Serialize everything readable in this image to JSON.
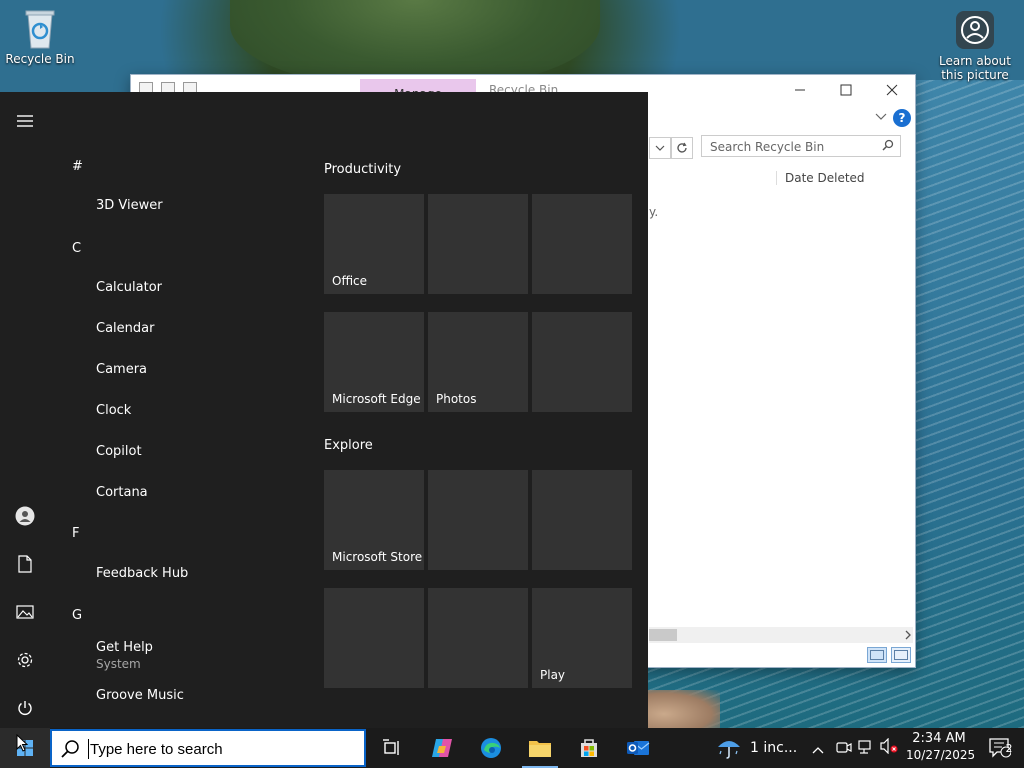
{
  "desktop": {
    "icons": [
      {
        "label": "Recycle Bin"
      },
      {
        "label": "Learn about this picture"
      }
    ]
  },
  "explorer": {
    "ribbon_tab": "Manage",
    "title": "Recycle Bin",
    "search_placeholder": "Search Recycle Bin",
    "column_header": "Date Deleted",
    "empty_text_fragment": "y."
  },
  "start_menu": {
    "apps": [
      {
        "type": "letter",
        "label": "#"
      },
      {
        "type": "app",
        "label": "3D Viewer"
      },
      {
        "type": "letter",
        "label": "C"
      },
      {
        "type": "app",
        "label": "Calculator"
      },
      {
        "type": "app",
        "label": "Calendar"
      },
      {
        "type": "app",
        "label": "Camera"
      },
      {
        "type": "app",
        "label": "Clock"
      },
      {
        "type": "app",
        "label": "Copilot"
      },
      {
        "type": "app",
        "label": "Cortana"
      },
      {
        "type": "letter",
        "label": "F"
      },
      {
        "type": "app",
        "label": "Feedback Hub"
      },
      {
        "type": "letter",
        "label": "G"
      },
      {
        "type": "app",
        "label": "Get Help",
        "sub": "System"
      },
      {
        "type": "app",
        "label": "Groove Music"
      }
    ],
    "sections": [
      {
        "title": "Productivity",
        "tiles": [
          "Office",
          "",
          "",
          "Microsoft Edge",
          "Photos",
          ""
        ]
      },
      {
        "title": "Explore",
        "tiles": [
          "Microsoft Store",
          "",
          "",
          "",
          "",
          "Play"
        ]
      }
    ],
    "rail_icons": [
      "hamburger-icon",
      "user-icon",
      "documents-icon",
      "pictures-icon",
      "settings-icon",
      "power-icon"
    ]
  },
  "taskbar": {
    "search_placeholder": "Type here to search",
    "weather_text": "1 inc...",
    "time": "2:34 AM",
    "date": "10/27/2025",
    "notification_count": "2"
  },
  "colors": {
    "start_bg": "#1f1f1f",
    "tile_bg": "#333333",
    "taskbar_bg": "#1b1b1b",
    "accent": "#0a64c8"
  }
}
